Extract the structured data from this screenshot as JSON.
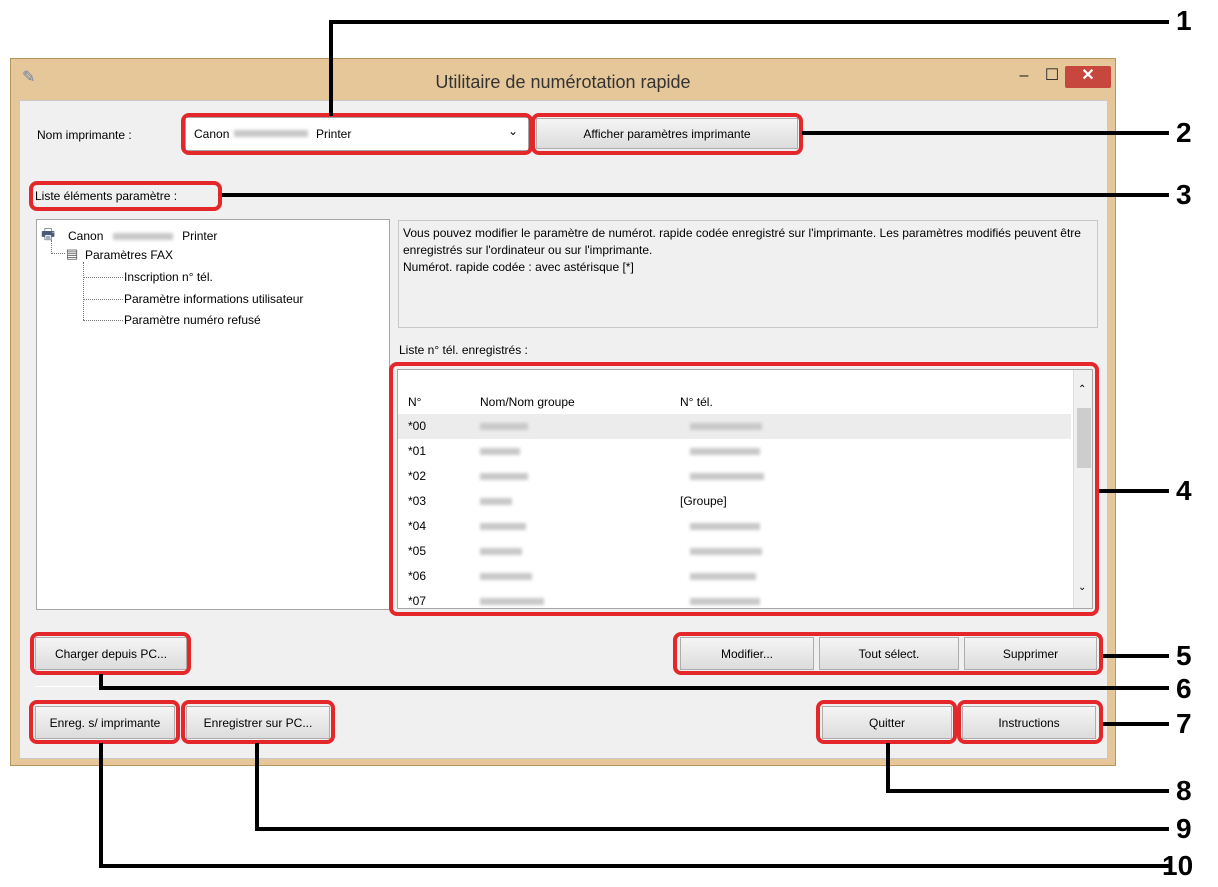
{
  "window": {
    "title": "Utilitaire de numérotation rapide"
  },
  "printer": {
    "label": "Nom imprimante :",
    "value_prefix": "Canon",
    "value_suffix": "Printer",
    "show_settings_button": "Afficher paramètres imprimante"
  },
  "settings_list": {
    "label": "Liste éléments paramètre :",
    "tree": {
      "root_prefix": "Canon",
      "root_suffix": "Printer",
      "fax": "Paramètres FAX",
      "items": [
        "Inscription n° tél.",
        "Paramètre informations utilisateur",
        "Paramètre numéro refusé"
      ]
    }
  },
  "description": "Vous pouvez modifier le paramètre de numérot. rapide codée enregistré sur l'imprimante. Les paramètres modifiés peuvent être enregistrés sur l'ordinateur ou sur l'imprimante.\nNumérot. rapide codée : avec astérisque [*]",
  "phone_list": {
    "label": "Liste n° tél. enregistrés :",
    "columns": [
      "N°",
      "Nom/Nom groupe",
      "N° tél."
    ],
    "rows": [
      {
        "n": "*00",
        "tel": ""
      },
      {
        "n": "*01",
        "tel": ""
      },
      {
        "n": "*02",
        "tel": ""
      },
      {
        "n": "*03",
        "tel": "[Groupe]"
      },
      {
        "n": "*04",
        "tel": ""
      },
      {
        "n": "*05",
        "tel": ""
      },
      {
        "n": "*06",
        "tel": ""
      },
      {
        "n": "*07",
        "tel": ""
      }
    ]
  },
  "buttons": {
    "load_from_pc": "Charger depuis PC...",
    "edit": "Modifier...",
    "select_all": "Tout sélect.",
    "delete": "Supprimer",
    "save_to_printer": "Enreg. s/ imprimante",
    "save_to_pc": "Enregistrer sur PC...",
    "quit": "Quitter",
    "instructions": "Instructions"
  },
  "callouts": [
    "1",
    "2",
    "3",
    "4",
    "5",
    "6",
    "7",
    "8",
    "9",
    "10"
  ],
  "colors": {
    "highlight": "#e3272b",
    "titlebar": "#e6c79a",
    "close_button": "#c7463e"
  }
}
